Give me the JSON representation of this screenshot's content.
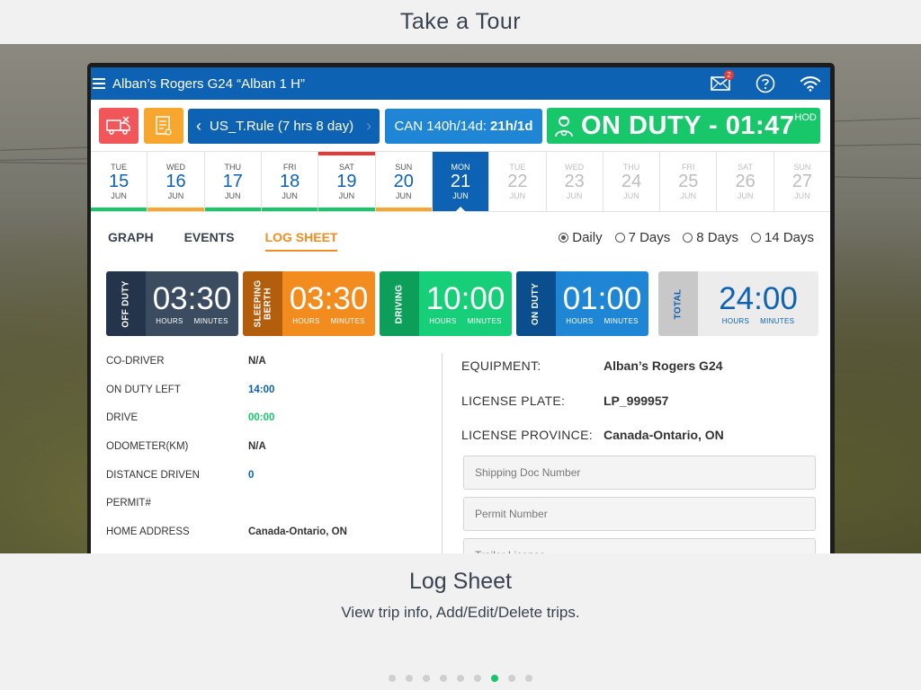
{
  "tour": {
    "title": "Take a Tour"
  },
  "app": {
    "title": "Alban’s Rogers G24 “Alban 1 H”",
    "mail_badge": "2",
    "rule_label": "US_T.Rule (7 hrs 8 day)",
    "can_label": "CAN 140h/14d:",
    "can_value": "21h/1d",
    "status_label": "ON DUTY - 01:47",
    "status_sup": "HOD",
    "colors": {
      "primary": "#0e62b3",
      "on_duty": "#17c76a",
      "accent": "#f28c1e",
      "alert": "#f0565a",
      "warn": "#f7a72d"
    }
  },
  "dates": [
    {
      "dow": "TUE",
      "day": "15",
      "mon": "JUN",
      "state": "past",
      "top": "",
      "bottom": "#17c76a"
    },
    {
      "dow": "WED",
      "day": "16",
      "mon": "JUN",
      "state": "past",
      "top": "",
      "bottom": "#f7a72d"
    },
    {
      "dow": "THU",
      "day": "17",
      "mon": "JUN",
      "state": "past",
      "top": "",
      "bottom": "#17c76a"
    },
    {
      "dow": "FRI",
      "day": "18",
      "mon": "JUN",
      "state": "past",
      "top": "",
      "bottom": "#17c76a"
    },
    {
      "dow": "SAT",
      "day": "19",
      "mon": "JUN",
      "state": "past",
      "top": "#e53935",
      "bottom": "#17c76a"
    },
    {
      "dow": "SUN",
      "day": "20",
      "mon": "JUN",
      "state": "past",
      "top": "",
      "bottom": "#f7a72d"
    },
    {
      "dow": "MON",
      "day": "21",
      "mon": "JUN",
      "state": "selected",
      "top": "",
      "bottom": ""
    },
    {
      "dow": "TUE",
      "day": "22",
      "mon": "JUN",
      "state": "future",
      "top": "",
      "bottom": ""
    },
    {
      "dow": "WED",
      "day": "23",
      "mon": "JUN",
      "state": "future",
      "top": "",
      "bottom": ""
    },
    {
      "dow": "THU",
      "day": "24",
      "mon": "JUN",
      "state": "future",
      "top": "",
      "bottom": ""
    },
    {
      "dow": "FRI",
      "day": "25",
      "mon": "JUN",
      "state": "future",
      "top": "",
      "bottom": ""
    },
    {
      "dow": "SAT",
      "day": "26",
      "mon": "JUN",
      "state": "future",
      "top": "",
      "bottom": ""
    },
    {
      "dow": "SUN",
      "day": "27",
      "mon": "JUN",
      "state": "future",
      "top": "",
      "bottom": ""
    }
  ],
  "tabs": [
    {
      "label": "GRAPH",
      "active": false
    },
    {
      "label": "EVENTS",
      "active": false
    },
    {
      "label": "LOG SHEET",
      "active": true
    }
  ],
  "ranges": [
    {
      "label": "Daily",
      "selected": true
    },
    {
      "label": "7 Days",
      "selected": false
    },
    {
      "label": "8 Days",
      "selected": false
    },
    {
      "label": "14 Days",
      "selected": false
    }
  ],
  "summary": {
    "hours_label": "HOURS",
    "minutes_label": "MINUTES",
    "off_duty": {
      "label": "OFF DUTY",
      "value": "03:30"
    },
    "sleeping": {
      "label1": "SLEEPING",
      "label2": "BERTH",
      "value": "03:30"
    },
    "driving": {
      "label": "DRIVING",
      "value": "10:00"
    },
    "on_duty": {
      "label": "ON DUTY",
      "value": "01:00"
    },
    "total": {
      "label": "TOTAL",
      "value": "24:00"
    }
  },
  "details": [
    {
      "key": "CO-DRIVER",
      "value": "N/A",
      "tone": ""
    },
    {
      "key": "ON DUTY LEFT",
      "value": "14:00",
      "tone": "blue"
    },
    {
      "key": "DRIVE",
      "value": "00:00",
      "tone": "green"
    },
    {
      "key": "ODOMETER(KM)",
      "value": "N/A",
      "tone": ""
    },
    {
      "key": "DISTANCE DRIVEN",
      "value": "0",
      "tone": "blue"
    },
    {
      "key": "PERMIT#",
      "value": "",
      "tone": ""
    },
    {
      "key": "HOME ADDRESS",
      "value": "Canada-Ontario, ON",
      "tone": ""
    }
  ],
  "equipment": [
    {
      "key": "EQUIPMENT:",
      "value": "Alban’s Rogers G24"
    },
    {
      "key": "LICENSE PLATE:",
      "value": "LP_999957"
    },
    {
      "key": "LICENSE PROVINCE:",
      "value": "Canada-Ontario, ON"
    }
  ],
  "fields": {
    "shipping_placeholder": "Shipping Doc Number",
    "permit_placeholder": "Permit Number",
    "trailer_placeholder": "Trailer License"
  },
  "caption": {
    "title": "Log Sheet",
    "subtitle": "View trip info, Add/Edit/Delete trips."
  },
  "pager": {
    "count": 9,
    "active_index": 6
  }
}
